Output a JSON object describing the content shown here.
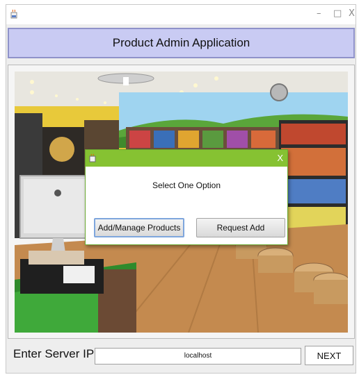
{
  "window": {
    "icon": "java-cup-icon",
    "controls": {
      "minimize": "–",
      "maximize": "□",
      "close": "X"
    }
  },
  "header": {
    "title": "Product Admin Application"
  },
  "background_image": {
    "description_icon": "pet-store-photo"
  },
  "dialog": {
    "icon": "java-cup-icon",
    "close": "X",
    "message": "Select One Option",
    "buttons": {
      "manage": "Add/Manage Products",
      "request": "Request Add"
    }
  },
  "footer": {
    "label": "Enter Server IP ...",
    "ip_value": "localhost",
    "next_label": "NEXT"
  },
  "colors": {
    "header_bg": "#c9cbf3",
    "header_border": "#8f92c9",
    "dialog_title_bg": "#86c232"
  }
}
